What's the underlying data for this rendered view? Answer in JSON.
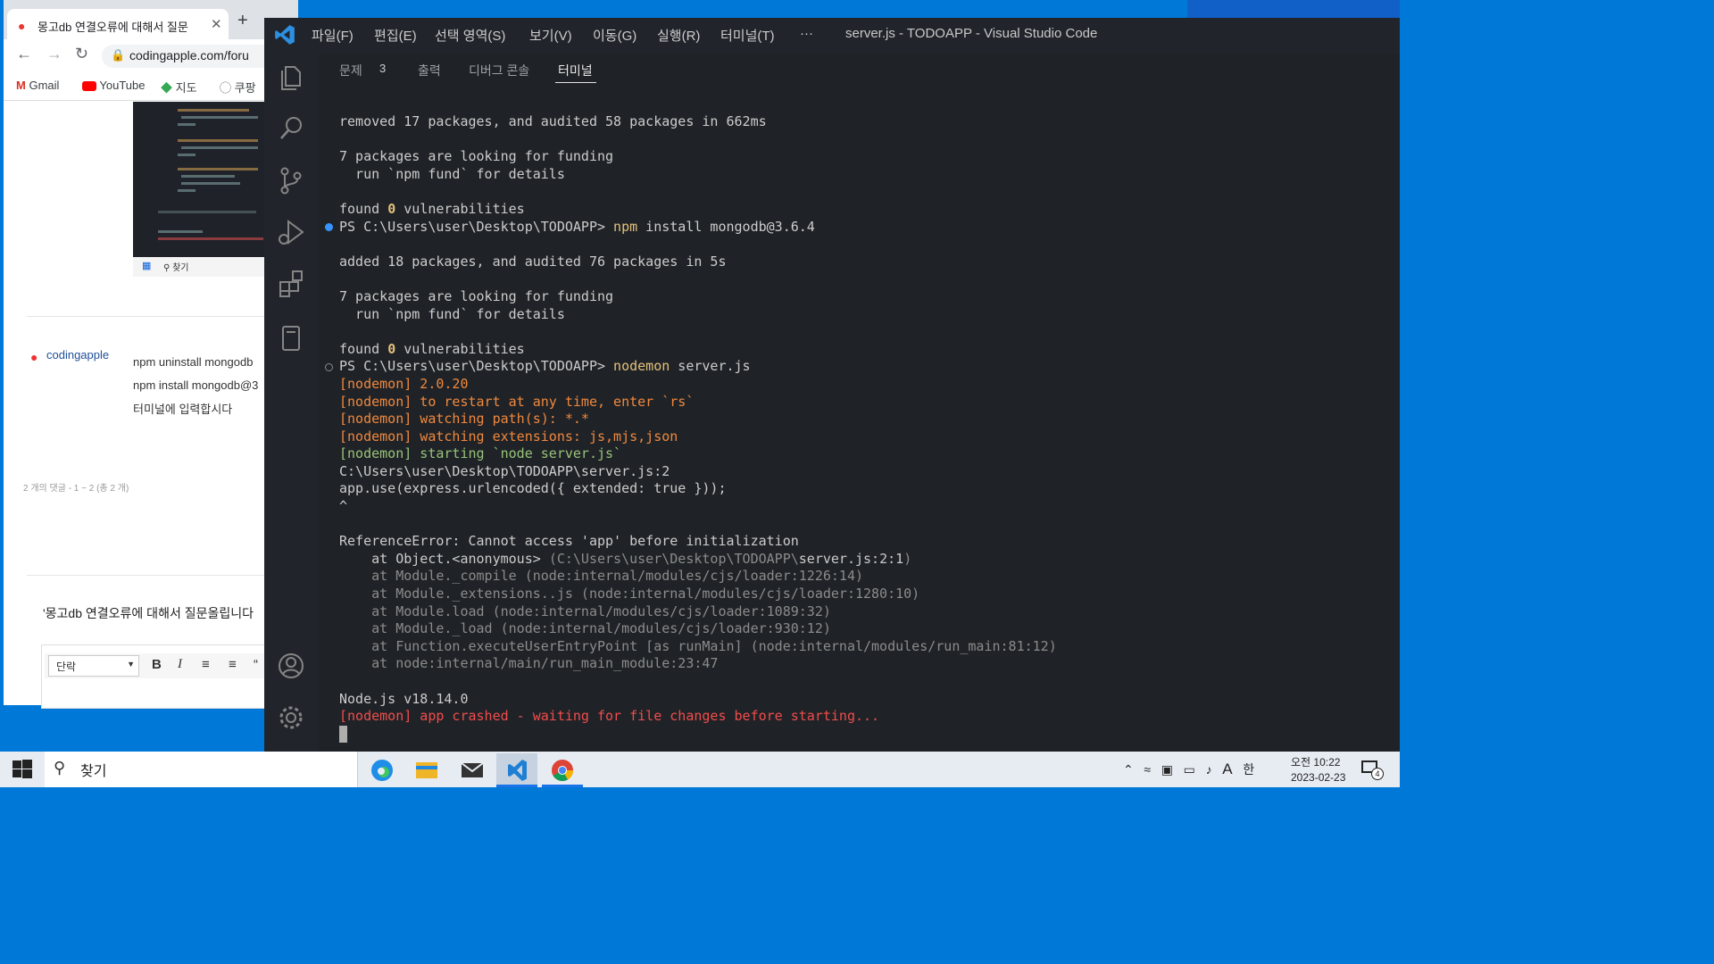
{
  "chrome": {
    "tab_title": "몽고db 연결오류에 대해서 질문",
    "address": "codingapple.com/foru",
    "bookmarks": [
      "Gmail",
      "YouTube",
      "지도",
      "쿠팡"
    ],
    "comment": {
      "author": "codingapple",
      "lines": [
        "npm uninstall mongodb",
        "npm install mongodb@3",
        "터미널에 입력합시다"
      ]
    },
    "pager": "2 개의 댓글 - 1 ~ 2 (총 2 개)",
    "reply_title": "'몽고db 연결오류에 대해서 질문올립니다",
    "editor_paragraph": "단락",
    "thumb_search": "찾기"
  },
  "vscode": {
    "menus": [
      "파일(F)",
      "편집(E)",
      "선택 영역(S)",
      "보기(V)",
      "이동(G)",
      "실행(R)",
      "터미널(T)",
      "···"
    ],
    "window_title": "server.js - TODOAPP - Visual Studio Code",
    "panel_tabs": {
      "problems": "문제",
      "problems_count": "3",
      "output": "출력",
      "debug_console": "디버그 콘솔",
      "terminal": "터미널"
    }
  },
  "terminal": {
    "l01": "removed 17 packages, and audited 58 packages in 662ms",
    "l02": "7 packages are looking for funding",
    "l03": "  run `npm fund` for details",
    "l04a": "found ",
    "l04b": "0",
    "l04c": " vulnerabilities",
    "l05a": "PS C:\\Users\\user\\Desktop\\TODOAPP> ",
    "l05b": "npm",
    "l05c": " install mongodb@3.6.4",
    "l06": "added 18 packages, and audited 76 packages in 5s",
    "l07": "7 packages are looking for funding",
    "l08": "  run `npm fund` for details",
    "l09a": "found ",
    "l09b": "0",
    "l09c": " vulnerabilities",
    "l10a": "PS C:\\Users\\user\\Desktop\\TODOAPP> ",
    "l10b": "nodemon",
    "l10c": " server.js",
    "l11": "[nodemon] 2.0.20",
    "l12": "[nodemon] to restart at any time, enter `rs`",
    "l13": "[nodemon] watching path(s): *.*",
    "l14": "[nodemon] watching extensions: js,mjs,json",
    "l15": "[nodemon] starting `node server.js`",
    "l16": "C:\\Users\\user\\Desktop\\TODOAPP\\server.js:2",
    "l17": "app.use(express.urlencoded({ extended: true }));",
    "l18": "^",
    "l19": "ReferenceError: Cannot access 'app' before initialization",
    "l20a": "    at Object.<anonymous> ",
    "l20b": "(C:\\Users\\user\\Desktop\\TODOAPP\\",
    "l20c": "server.js:2:1",
    "l20d": ")",
    "l21": "    at Module._compile (node:internal/modules/cjs/loader:1226:14)",
    "l22": "    at Module._extensions..js (node:internal/modules/cjs/loader:1280:10)",
    "l23": "    at Module.load (node:internal/modules/cjs/loader:1089:32)",
    "l24": "    at Module._load (node:internal/modules/cjs/loader:930:12)",
    "l25": "    at Function.executeUserEntryPoint [as runMain] (node:internal/modules/run_main:81:12)",
    "l26": "    at node:internal/main/run_main_module:23:47",
    "l27": "Node.js v18.14.0",
    "l28": "[nodemon] app crashed - waiting for file changes before starting..."
  },
  "taskbar": {
    "search_text": "찾기",
    "ime": "A",
    "ime2": "한",
    "time": "오전 10:22",
    "date": "2023-02-23",
    "notifications": "4"
  },
  "colors": {
    "vscode_blue": "#2c8fe0",
    "terminal_bg": "#1f2327",
    "taskbar": "#e7ecf3"
  }
}
